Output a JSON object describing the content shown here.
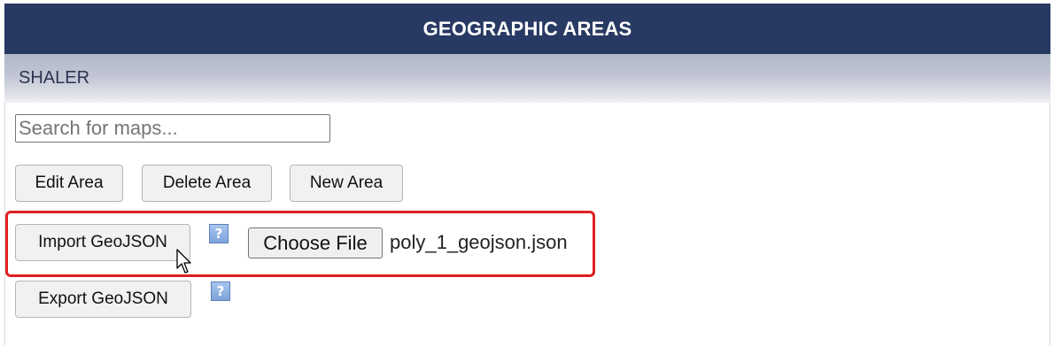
{
  "header": {
    "title": "GEOGRAPHIC AREAS"
  },
  "subheader": {
    "label": "SHALER"
  },
  "search": {
    "placeholder": "Search for maps...",
    "value": ""
  },
  "actions": {
    "edit_label": "Edit Area",
    "delete_label": "Delete Area",
    "new_label": "New Area"
  },
  "import": {
    "button_label": "Import GeoJSON",
    "help_icon": "?",
    "choose_file_label": "Choose File",
    "file_name": "poly_1_geojson.json"
  },
  "export": {
    "button_label": "Export GeoJSON",
    "help_icon": "?"
  },
  "icons": {
    "help": "help-icon",
    "cursor": "mouse-pointer-icon"
  },
  "colors": {
    "header_bg": "#283a63",
    "highlight": "#e02020",
    "help_icon": "#7da3da"
  }
}
